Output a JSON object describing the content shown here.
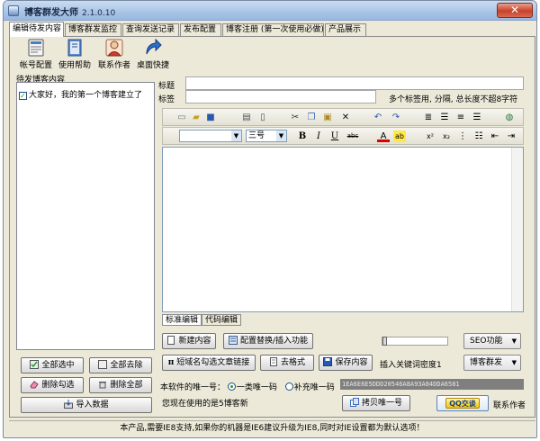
{
  "window": {
    "title": "博客群发大师",
    "version": "2.1.0.10"
  },
  "tabs": [
    {
      "label": "编辑待发内容",
      "active": true
    },
    {
      "label": "博客群发监控",
      "active": false
    },
    {
      "label": "查询发送记录",
      "active": false
    },
    {
      "label": "发布配置",
      "active": false
    },
    {
      "label": "博客注册 (第一次使用必做)",
      "active": false
    },
    {
      "label": "产品展示",
      "active": false
    }
  ],
  "quick_buttons": [
    {
      "label": "帐号配置",
      "icon": "account-config-icon"
    },
    {
      "label": "使用帮助",
      "icon": "help-book-icon"
    },
    {
      "label": "联系作者",
      "icon": "person-icon"
    },
    {
      "label": "桌面快捷",
      "icon": "shortcut-arrow-icon"
    }
  ],
  "left_panel": {
    "header": "待发博客内容",
    "items": [
      {
        "text": "大家好，我的第一个博客建立了",
        "checked": true
      }
    ],
    "buttons": {
      "select_all": "全部选中",
      "deselect_all": "全部去除",
      "delete_checked": "删除勾选",
      "delete_all": "删除全部",
      "import": "导入数据"
    }
  },
  "form": {
    "title_label": "标题",
    "title_value": "",
    "tags_label": "标签",
    "tags_value": "",
    "tags_hint": "多个标签用, 分隔, 总长度不超8字符"
  },
  "editor_toolbar": {
    "font_name": "",
    "font_size": "三号"
  },
  "editor": {
    "content": "",
    "mode_tabs": [
      "标准编辑",
      "代码编辑"
    ],
    "active_mode": "标准编辑"
  },
  "actions": {
    "new_content": "新建内容",
    "config_replace": "配置替换/插入功能",
    "short_domain": "短域名勾选文章链接",
    "clear_format": "去格式",
    "save_content": "保存内容",
    "seo": "SEO功能",
    "blog_post": "博客群发",
    "keyword_density_label": "插入关键词密度",
    "keyword_density_value": "1"
  },
  "uid": {
    "label": "本软件的唯一号：",
    "option_1": "一类唯一码",
    "option_2": "补充唯一码",
    "selected": "一类唯一码",
    "code": "1EA6E6E5DDD20546A8A93A84DDA6581",
    "current_label": "您现在使用的是5博客新",
    "copy_button": "拷贝唯一号",
    "qq_label": "QQ交谈",
    "contact_author": "联系作者"
  },
  "statusbar": {
    "text": "本产品,需要IE8支持,如果你的机器是IE6建议升级为IE8,同时对IE设置都为默认选项！"
  },
  "colors": {
    "window_bg": "#ece9d8",
    "title_gradient": "#a8c4e6",
    "close_red": "#c8412b",
    "check_green": "#21a121"
  }
}
